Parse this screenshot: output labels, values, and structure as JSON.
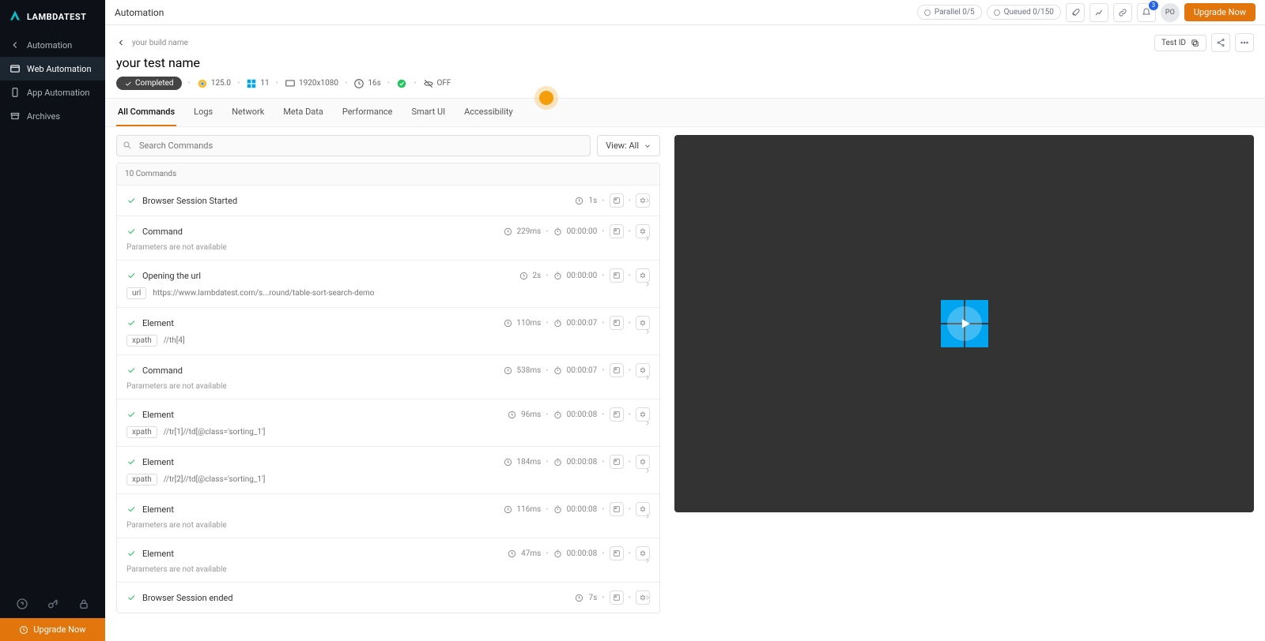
{
  "brand": "LAMBDATEST",
  "sidebar": {
    "items": [
      {
        "label": "Automation",
        "active": false,
        "hasBack": true
      },
      {
        "label": "Web Automation",
        "active": true
      },
      {
        "label": "App Automation",
        "active": false
      },
      {
        "label": "Archives",
        "active": false
      }
    ],
    "upgrade": "Upgrade Now"
  },
  "topbar": {
    "title": "Automation",
    "parallel": "Parallel 0/5",
    "queued": "Queued 0/150",
    "notif_badge": "3",
    "avatar": "PO",
    "upgrade": "Upgrade Now"
  },
  "header": {
    "build": "your build name",
    "test": "your test name",
    "testid_label": "Test ID",
    "status": "Completed",
    "chrome": "125.0",
    "windows": "11",
    "resolution": "1920x1080",
    "duration": "16s",
    "flag": "OFF"
  },
  "tabs": [
    "All Commands",
    "Logs",
    "Network",
    "Meta Data",
    "Performance",
    "Smart UI",
    "Accessibility"
  ],
  "search": {
    "placeholder": "Search Commands"
  },
  "view": "View: All",
  "cmd_header": "10 Commands",
  "commands": [
    {
      "name": "Browser Session Started",
      "dur": "1s",
      "ts": "",
      "sub": "",
      "param": null
    },
    {
      "name": "Command",
      "dur": "229ms",
      "ts": "00:00:00",
      "sub": "Parameters are not available",
      "param": null
    },
    {
      "name": "Opening the url",
      "dur": "2s",
      "ts": "00:00:00",
      "sub": "",
      "param": {
        "k": "url",
        "v": "https://www.lambdatest.com/s...round/table-sort-search-demo"
      }
    },
    {
      "name": "Element",
      "dur": "110ms",
      "ts": "00:00:07",
      "sub": "",
      "param": {
        "k": "xpath",
        "v": "//th[4]"
      }
    },
    {
      "name": "Command",
      "dur": "538ms",
      "ts": "00:00:07",
      "sub": "Parameters are not available",
      "param": null
    },
    {
      "name": "Element",
      "dur": "96ms",
      "ts": "00:00:08",
      "sub": "",
      "param": {
        "k": "xpath",
        "v": "//tr[1]//td[@class='sorting_1']"
      }
    },
    {
      "name": "Element",
      "dur": "184ms",
      "ts": "00:00:08",
      "sub": "",
      "param": {
        "k": "xpath",
        "v": "//tr[2]//td[@class='sorting_1']"
      }
    },
    {
      "name": "Element",
      "dur": "116ms",
      "ts": "00:00:08",
      "sub": "Parameters are not available",
      "param": null
    },
    {
      "name": "Element",
      "dur": "47ms",
      "ts": "00:00:08",
      "sub": "Parameters are not available",
      "param": null
    },
    {
      "name": "Browser Session ended",
      "dur": "7s",
      "ts": "",
      "sub": "",
      "param": null
    }
  ]
}
